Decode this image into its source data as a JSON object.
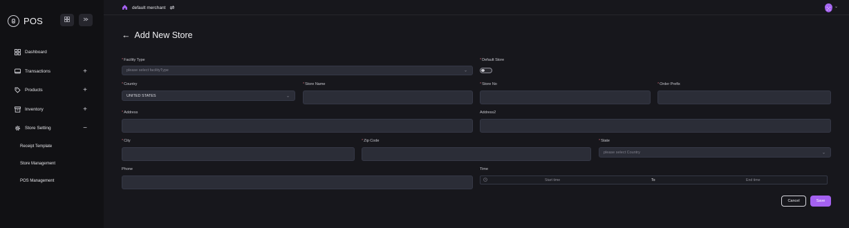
{
  "sidebar": {
    "app_name": "POS",
    "grid_icon": "grid-icon",
    "collapse_icon": "collapse-icon",
    "items": [
      {
        "label": "Dashboard",
        "icon": "dashboard-icon",
        "toggle": ""
      },
      {
        "label": "Transactions",
        "icon": "transactions-icon",
        "toggle": "+"
      },
      {
        "label": "Products",
        "icon": "tag-icon",
        "toggle": "+"
      },
      {
        "label": "Inventory",
        "icon": "archive-icon",
        "toggle": "+"
      },
      {
        "label": "Store Setting",
        "icon": "gear-icon",
        "toggle": "−"
      }
    ],
    "sub_items": [
      {
        "label": "Receipt Template"
      },
      {
        "label": "Store Management"
      },
      {
        "label": "POS Management"
      }
    ]
  },
  "topbar": {
    "merchant_name": "default merchant",
    "home_icon": "home-icon",
    "switch_icon": "switch-icon"
  },
  "page": {
    "back_arrow": "←",
    "title": "Add New Store"
  },
  "form": {
    "facility_type": {
      "label": "Facility Type",
      "placeholder": "please select facilityType"
    },
    "default_store": {
      "label": "Default Store",
      "enabled": false
    },
    "country": {
      "label": "Country",
      "value": "UNITED STATES"
    },
    "store_name": {
      "label": "Store Name",
      "value": ""
    },
    "store_no": {
      "label": "Store No",
      "value": ""
    },
    "order_prefix": {
      "label": "Order Prefix",
      "value": ""
    },
    "address": {
      "label": "Address",
      "value": ""
    },
    "address2": {
      "label": "Address2",
      "value": ""
    },
    "city": {
      "label": "City",
      "value": ""
    },
    "zip_code": {
      "label": "Zip Code",
      "value": ""
    },
    "state": {
      "label": "State",
      "placeholder": "please select Country"
    },
    "phone": {
      "label": "Phone",
      "value": ""
    },
    "time": {
      "label": "Time",
      "start_placeholder": "Start time",
      "separator": "To",
      "end_placeholder": "End time"
    }
  },
  "actions": {
    "cancel_label": "Cancel",
    "save_label": "Save"
  },
  "colors": {
    "accent": "#a461f0",
    "background": "#17171c",
    "sidebar": "#111114",
    "field": "#2b2d37",
    "required": "#c0616f"
  }
}
